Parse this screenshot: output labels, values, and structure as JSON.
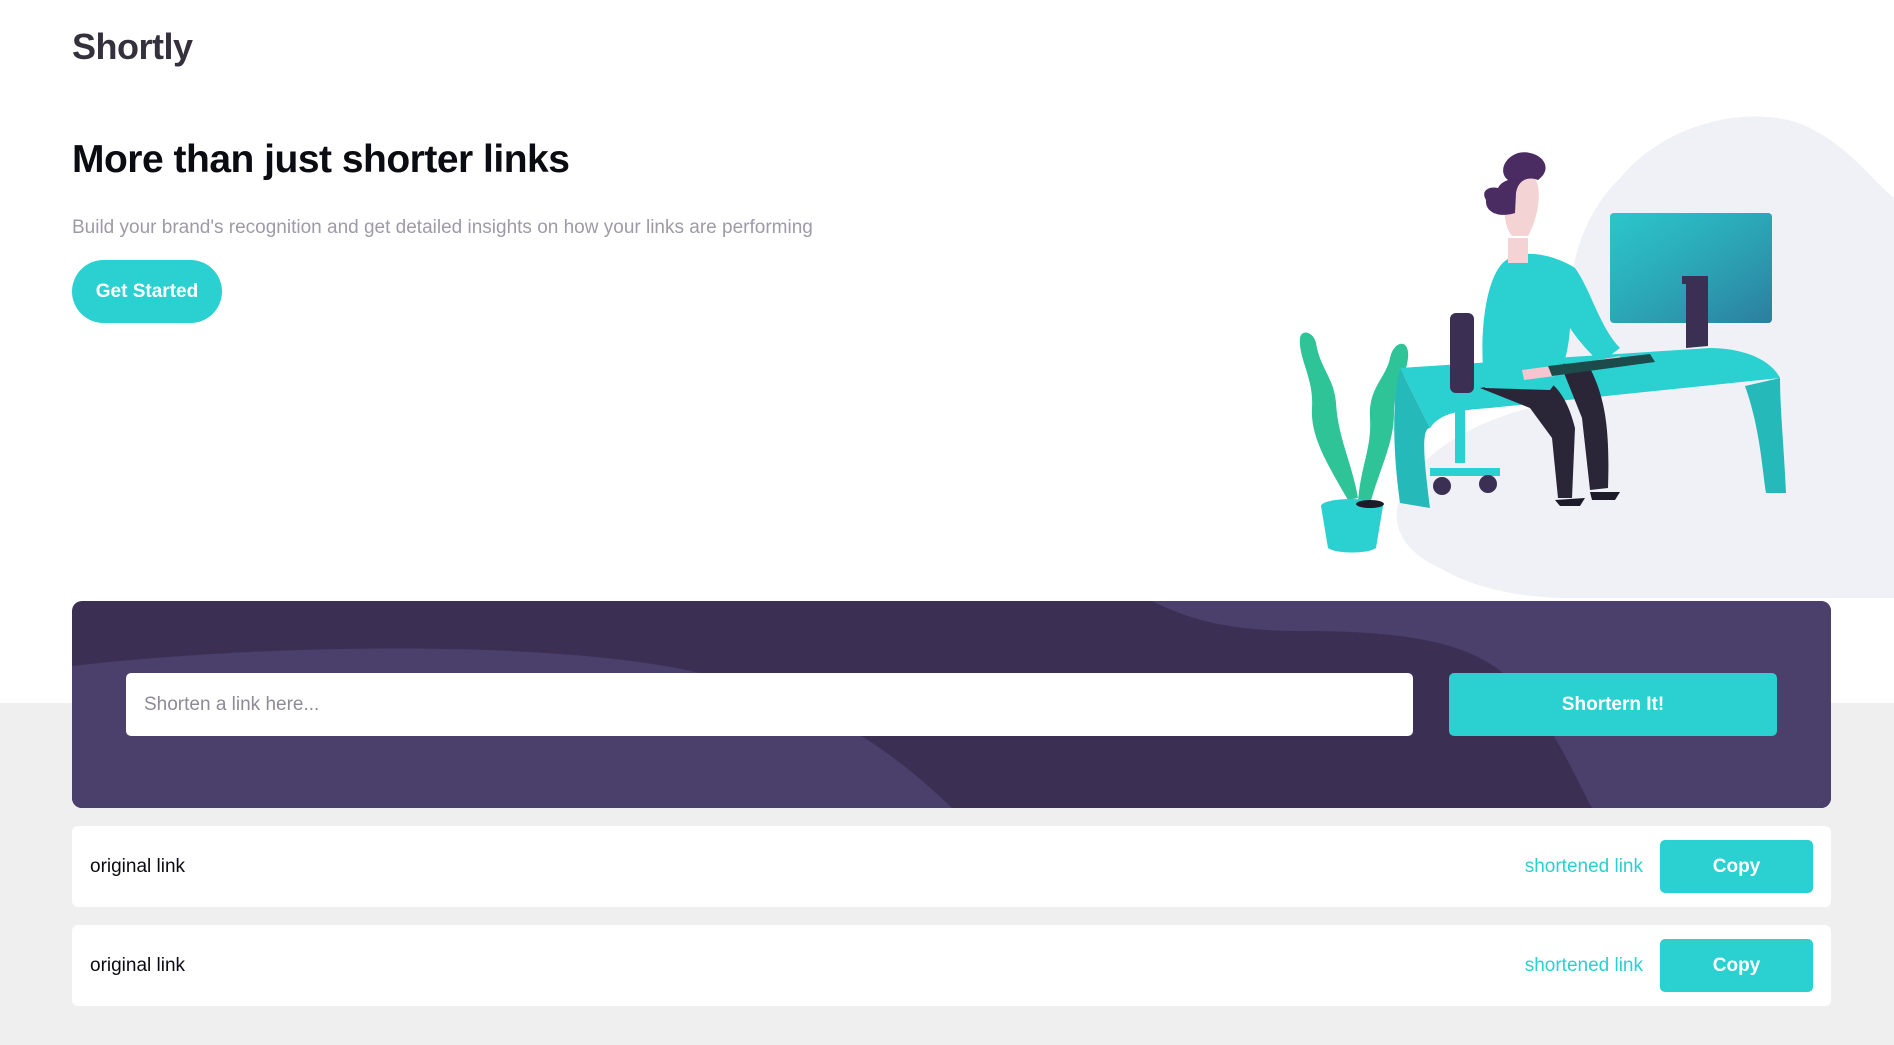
{
  "brand": {
    "logo_text": "Shortly",
    "accent": "#2bd0d0",
    "dark_violet": "#3b3054"
  },
  "hero": {
    "title": "More than just shorter links",
    "subtitle": "Build your brand's recognition and get detailed insights on how your links are performing",
    "cta_label": "Get Started",
    "illustration": "person-working-at-desk-illustration"
  },
  "shortener": {
    "placeholder": "Shorten a link here...",
    "button_label": "Shortern It!"
  },
  "results": [
    {
      "original": "original link",
      "shortened": "shortened link",
      "copy_label": "Copy"
    },
    {
      "original": "original link",
      "shortened": "shortened link",
      "copy_label": "Copy"
    }
  ]
}
